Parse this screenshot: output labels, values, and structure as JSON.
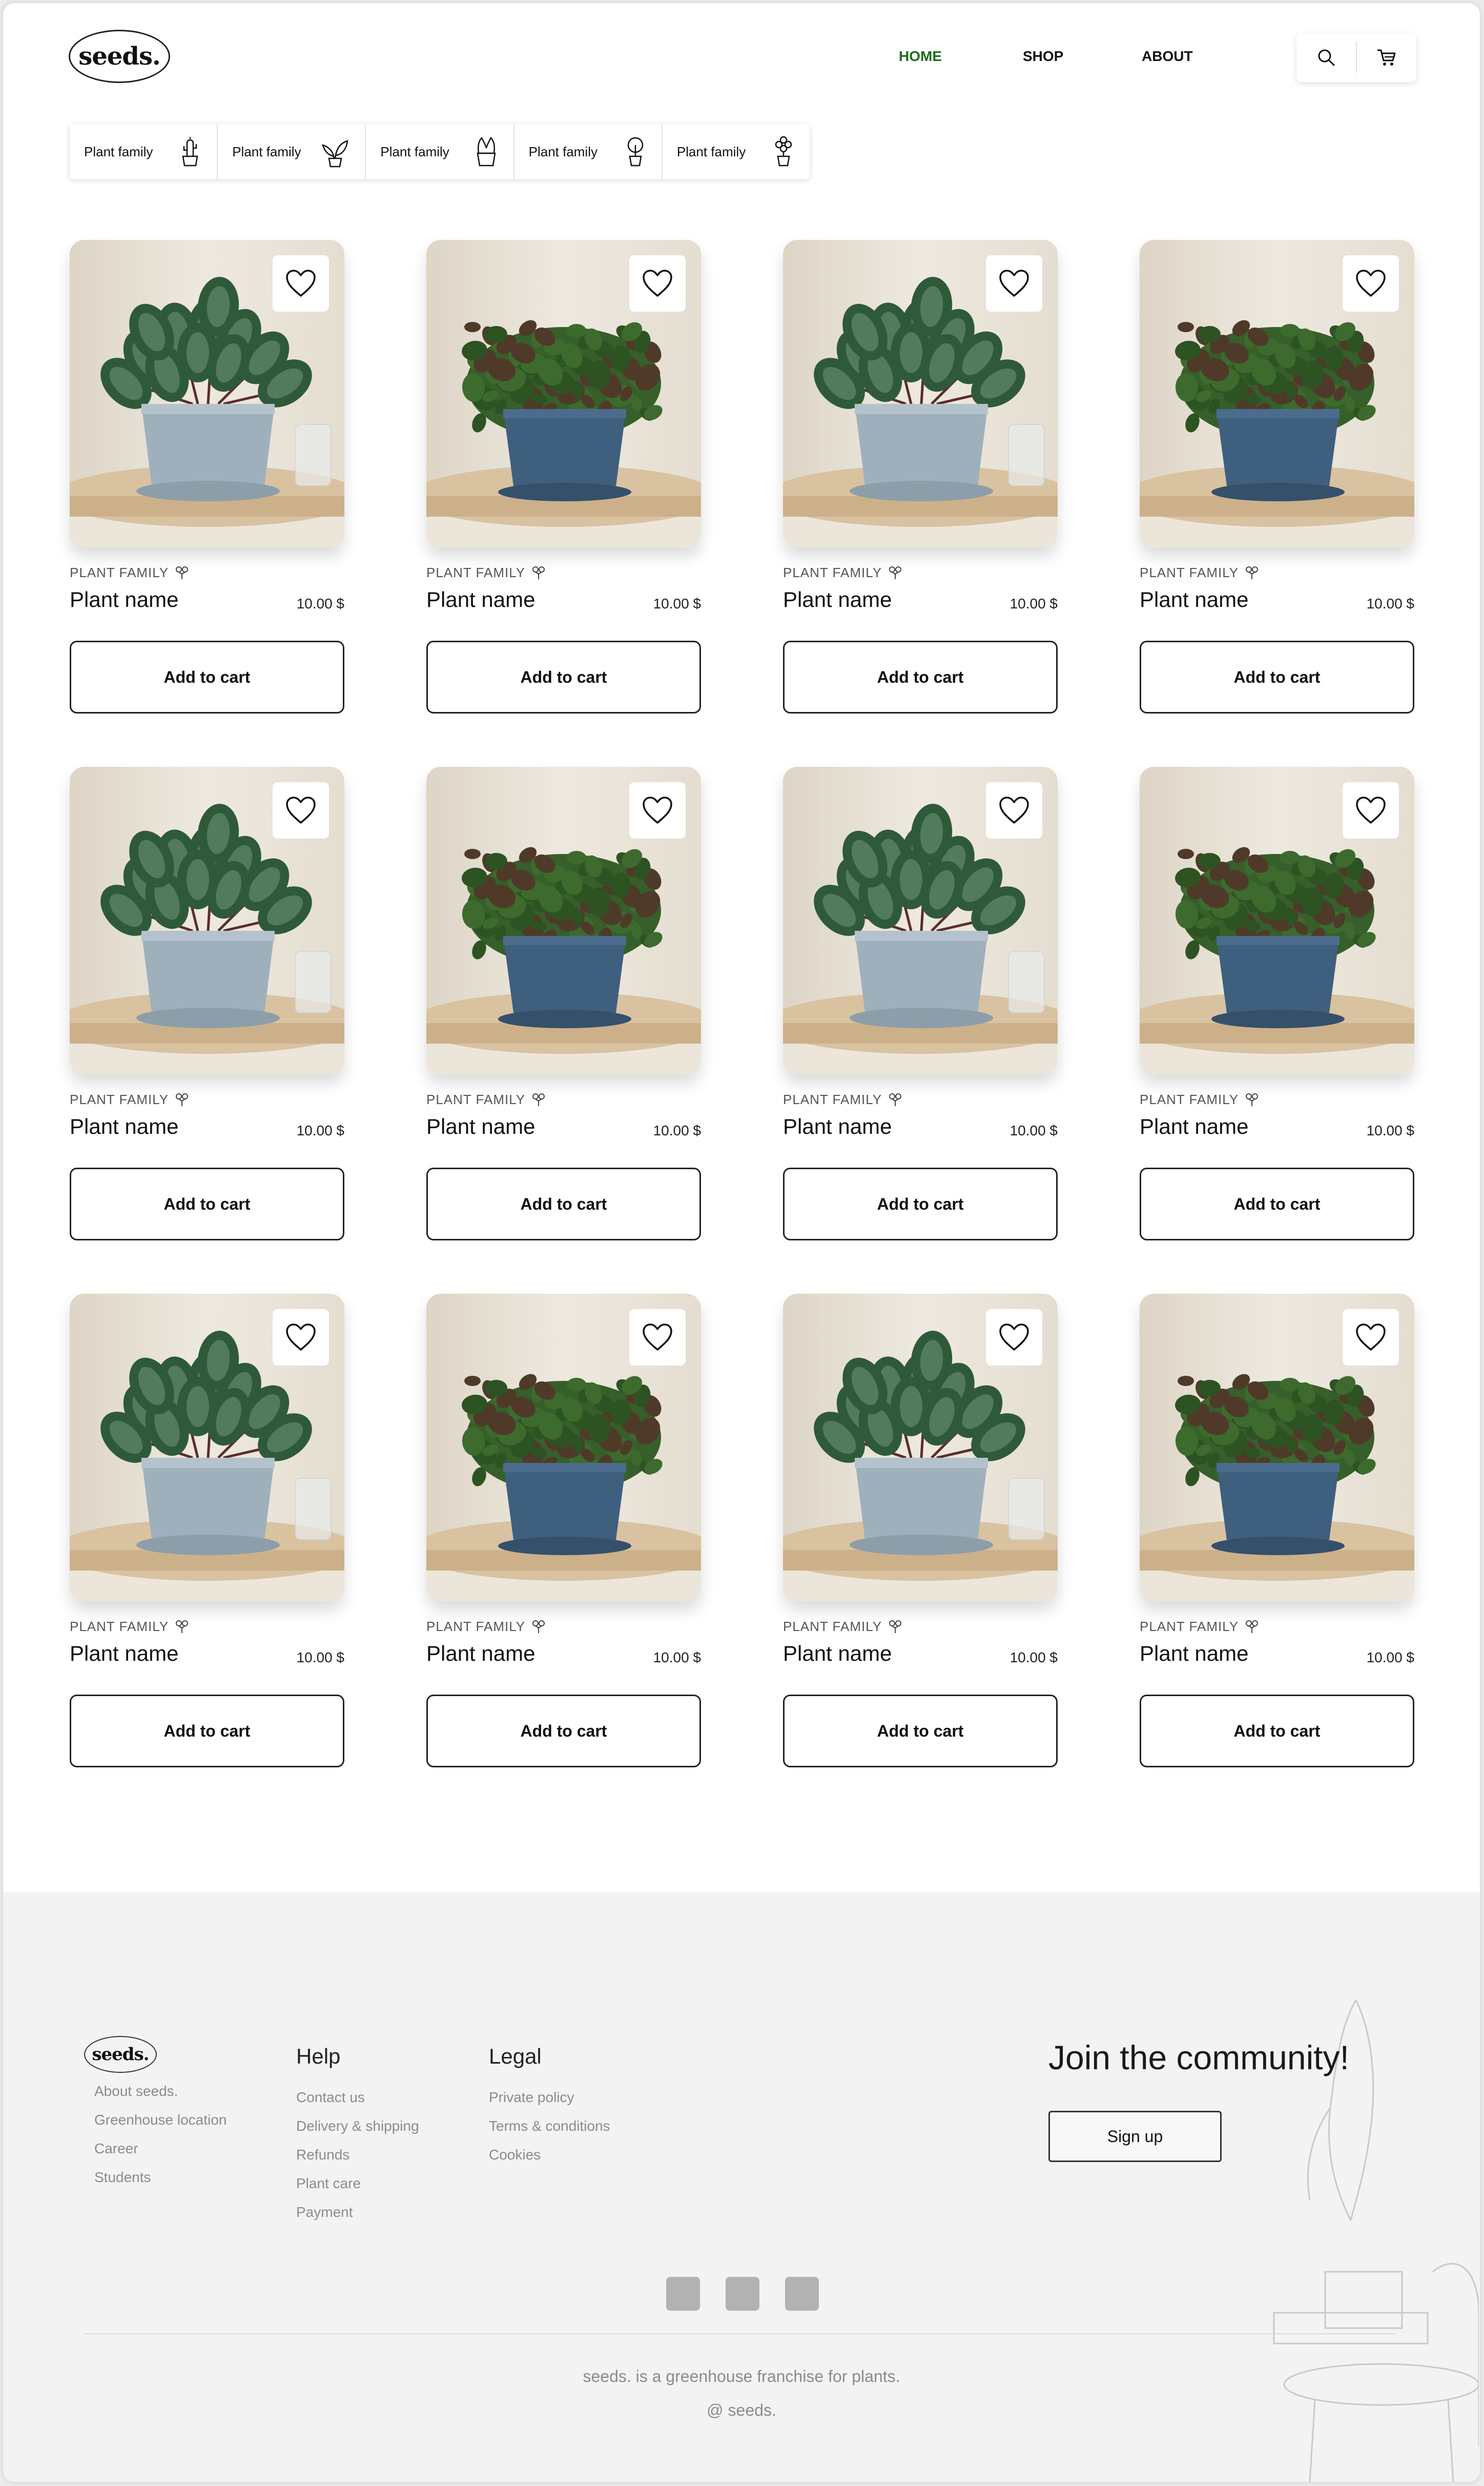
{
  "header": {
    "logo": "seeds.",
    "nav": [
      {
        "label": "HOME",
        "active": true
      },
      {
        "label": "SHOP",
        "active": false
      },
      {
        "label": "ABOUT",
        "active": false
      }
    ],
    "icons": [
      "search-icon",
      "cart-icon"
    ]
  },
  "filters": [
    {
      "label": "Plant family",
      "icon": "cactus-icon"
    },
    {
      "label": "Plant family",
      "icon": "leafy-plant-icon"
    },
    {
      "label": "Plant family",
      "icon": "tulip-pot-icon"
    },
    {
      "label": "Plant family",
      "icon": "round-plant-pot-icon"
    },
    {
      "label": "Plant family",
      "icon": "flower-pot-icon"
    }
  ],
  "products": [
    {
      "family": "PLANT FAMILY",
      "name": "Plant name",
      "price": "10.00 $",
      "button": "Add to cart",
      "image": "peperomia-grey-pot"
    },
    {
      "family": "PLANT FAMILY",
      "name": "Plant name",
      "price": "10.00 $",
      "button": "Add to cart",
      "image": "fern-blue-pot"
    },
    {
      "family": "PLANT FAMILY",
      "name": "Plant name",
      "price": "10.00 $",
      "button": "Add to cart",
      "image": "peperomia-grey-pot"
    },
    {
      "family": "PLANT FAMILY",
      "name": "Plant name",
      "price": "10.00 $",
      "button": "Add to cart",
      "image": "fern-blue-pot"
    },
    {
      "family": "PLANT FAMILY",
      "name": "Plant name",
      "price": "10.00 $",
      "button": "Add to cart",
      "image": "peperomia-grey-pot"
    },
    {
      "family": "PLANT FAMILY",
      "name": "Plant name",
      "price": "10.00 $",
      "button": "Add to cart",
      "image": "fern-blue-pot"
    },
    {
      "family": "PLANT FAMILY",
      "name": "Plant name",
      "price": "10.00 $",
      "button": "Add to cart",
      "image": "peperomia-grey-pot"
    },
    {
      "family": "PLANT FAMILY",
      "name": "Plant name",
      "price": "10.00 $",
      "button": "Add to cart",
      "image": "fern-blue-pot"
    },
    {
      "family": "PLANT FAMILY",
      "name": "Plant name",
      "price": "10.00 $",
      "button": "Add to cart",
      "image": "peperomia-grey-pot"
    },
    {
      "family": "PLANT FAMILY",
      "name": "Plant name",
      "price": "10.00 $",
      "button": "Add to cart",
      "image": "fern-blue-pot"
    },
    {
      "family": "PLANT FAMILY",
      "name": "Plant name",
      "price": "10.00 $",
      "button": "Add to cart",
      "image": "peperomia-grey-pot"
    },
    {
      "family": "PLANT FAMILY",
      "name": "Plant name",
      "price": "10.00 $",
      "button": "Add to cart",
      "image": "fern-blue-pot"
    }
  ],
  "footer": {
    "logo": "seeds.",
    "about_links": [
      "About seeds.",
      "Greenhouse location",
      "Career",
      "Students"
    ],
    "help": {
      "title": "Help",
      "links": [
        "Contact us",
        "Delivery & shipping",
        "Refunds",
        "Plant care",
        "Payment"
      ]
    },
    "legal": {
      "title": "Legal",
      "links": [
        "Private policy",
        "Terms & conditions",
        "Cookies"
      ]
    },
    "join_title": "Join the community!",
    "signup_label": "Sign up",
    "social_count": 3,
    "tagline": "seeds. is a greenhouse franchise for plants.",
    "copyright": "@ seeds."
  },
  "colors": {
    "accent_nav": "#1f6a1f",
    "footer_bg": "#f3f3f3",
    "grey_pot": "#9fb0bd",
    "blue_pot": "#3f5f7e"
  }
}
